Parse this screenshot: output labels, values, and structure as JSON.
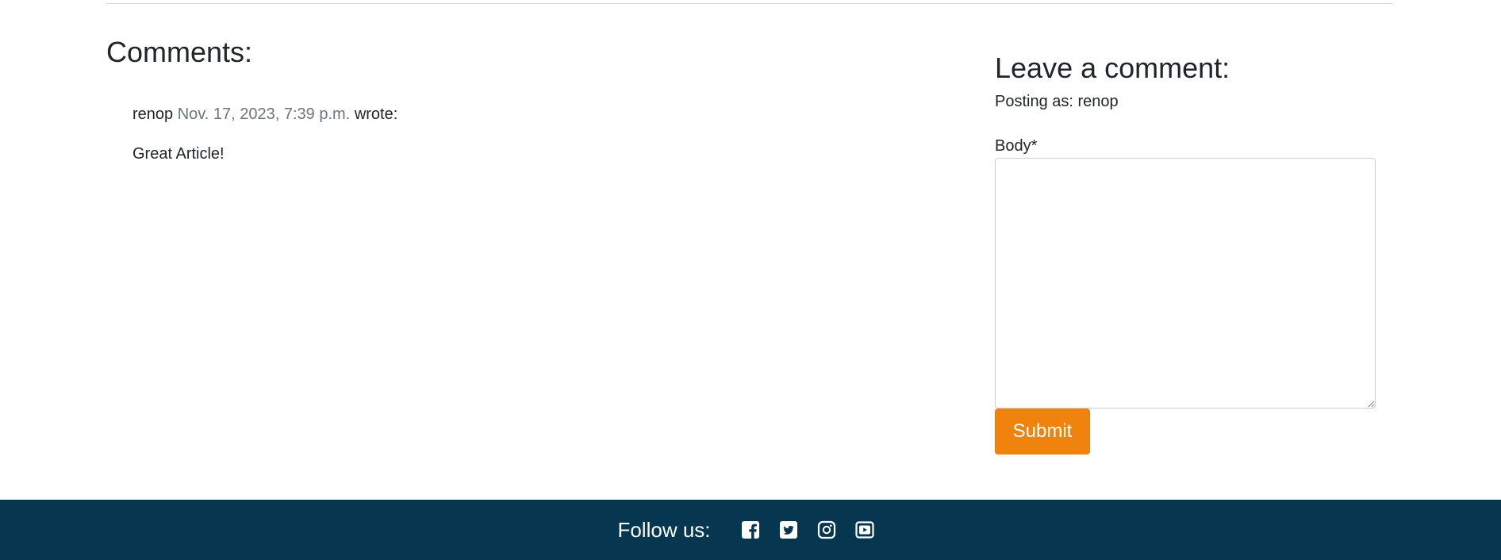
{
  "comments": {
    "title": "Comments:",
    "items": [
      {
        "author": "renop",
        "date": "Nov. 17, 2023, 7:39 p.m.",
        "wrote": "wrote:",
        "body": "Great Article!"
      }
    ]
  },
  "form": {
    "title": "Leave a comment:",
    "posting_as": "Posting as: renop",
    "body_label": "Body*",
    "body_value": "",
    "submit_label": "Submit"
  },
  "footer": {
    "follow_label": "Follow us:",
    "icons": [
      "facebook-icon",
      "twitter-icon",
      "instagram-icon",
      "youtube-icon"
    ]
  },
  "colors": {
    "accent": "#f0830e",
    "footer_bg": "#063650",
    "muted": "#6c757d",
    "text": "#212529"
  }
}
